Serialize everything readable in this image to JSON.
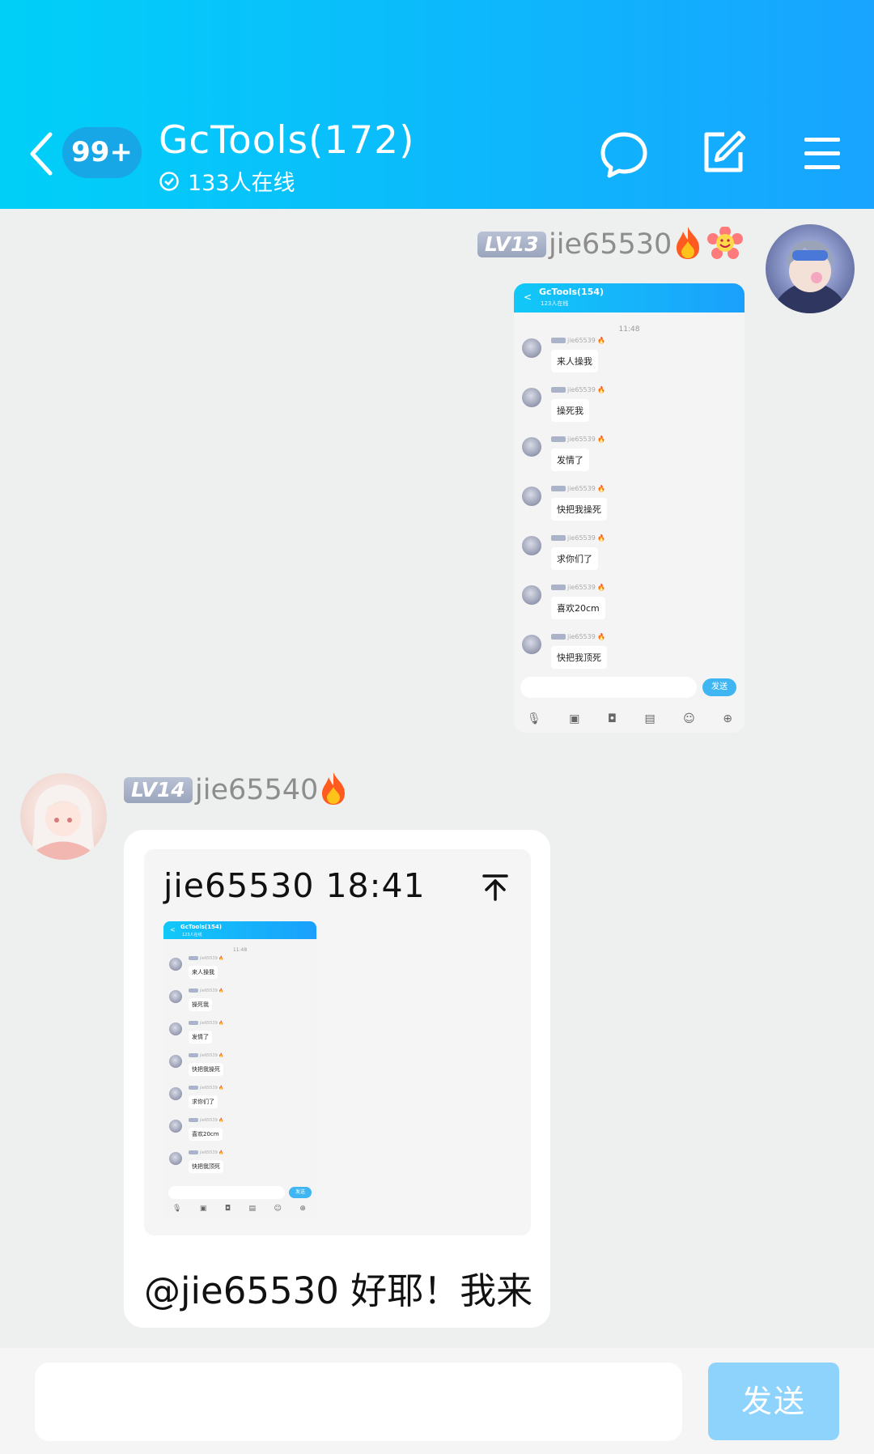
{
  "header": {
    "unread_badge": "99+",
    "group_title": "GcTools(172)",
    "online_text": "133人在线"
  },
  "messages": [
    {
      "level": "LV13",
      "username": "jie65530",
      "screenshot": {
        "title": "GcTools(154)",
        "subtitle": "123人在线",
        "time": "11:48",
        "sender": "jie65539",
        "sender_level": "LV22",
        "rows": [
          "来人操我",
          "操死我",
          "发情了",
          "快把我操死",
          "求你们了",
          "喜欢20cm",
          "快把我顶死"
        ],
        "send_label": "发送"
      }
    },
    {
      "level": "LV14",
      "username": "jie65540",
      "quote": {
        "header": "jie65530 18:41"
      },
      "text": "@jie65530 好耶！我来"
    }
  ],
  "input": {
    "placeholder": "",
    "send_label": "发送"
  },
  "colors": {
    "header_start": "#00d0f8",
    "header_end": "#18a4ff",
    "send_button": "#8ed3fb"
  }
}
